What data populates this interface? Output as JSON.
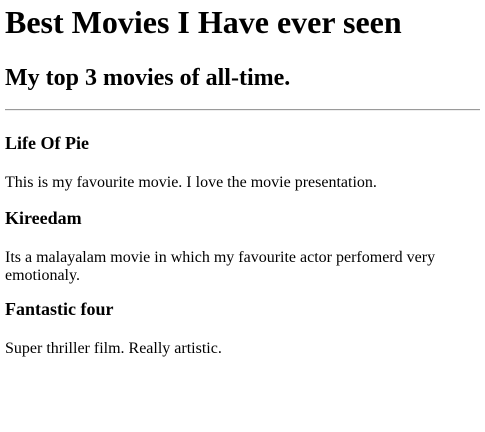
{
  "page": {
    "title": "Best Movies I Have ever seen",
    "subtitle": "My top 3 movies of all-time."
  },
  "movies": [
    {
      "title": "Life Of Pie",
      "description": "This is my favourite movie. I love the movie presentation."
    },
    {
      "title": "Kireedam",
      "description": "Its a malayalam movie in which my favourite actor perfomerd very emotionaly."
    },
    {
      "title": "Fantastic four",
      "description": "Super thriller film. Really artistic."
    }
  ]
}
